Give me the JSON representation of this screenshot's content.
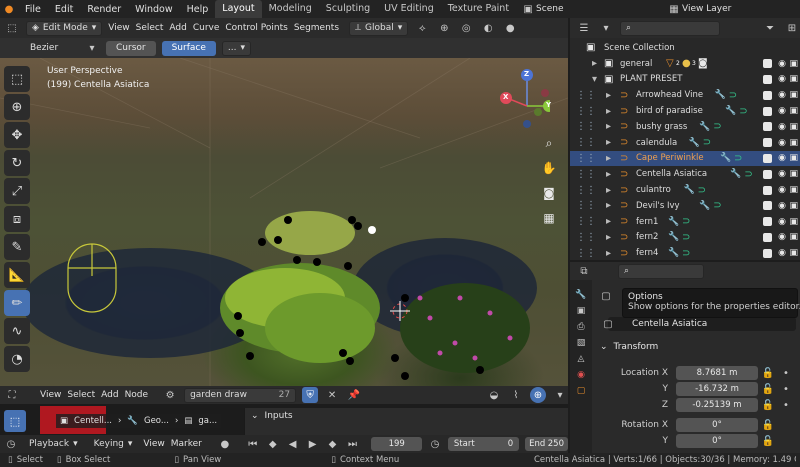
{
  "menu": {
    "items": [
      "File",
      "Edit",
      "Render",
      "Window",
      "Help"
    ],
    "workspaces": [
      "Layout",
      "Modeling",
      "Sculpting",
      "UV Editing",
      "Texture Paint"
    ],
    "active_workspace": "Layout",
    "scene_label": "Scene",
    "view_layer_label": "View Layer"
  },
  "viewport_header": {
    "mode": "Edit Mode",
    "menus": [
      "View",
      "Select",
      "Add",
      "Curve",
      "Control Points",
      "Segments"
    ],
    "orientation": "Global"
  },
  "curve_bar": {
    "type": "Bezier",
    "cursor_label": "Cursor",
    "surface_label": "Surface",
    "more": "..."
  },
  "viewport": {
    "perspective": "User Perspective",
    "object_info": "(199) Centella Asiatica",
    "gizmo": {
      "x": "X",
      "y": "Y",
      "z": "Z"
    },
    "toolbar": [
      "select-box-icon",
      "cursor-icon",
      "move-icon",
      "rotate-icon",
      "scale-icon",
      "transform-icon",
      "annotate-icon",
      "measure-icon",
      "draw-icon",
      "pen-icon",
      "radius-icon"
    ],
    "active_tool": 8
  },
  "outliner": {
    "collection": "Scene Collection",
    "general": "general",
    "general_counts": [
      "2",
      "3"
    ],
    "preset": "PLANT PRESET",
    "items": [
      "Arrowhead Vine",
      "bird of paradise",
      "bushy grass",
      "calendula",
      "Cape Periwinkle",
      "Centella Asiatica",
      "culantro",
      "Devil's Ivy",
      "fern1",
      "fern2",
      "fern4"
    ],
    "selected_index": 4,
    "active_index": 5
  },
  "properties": {
    "tooltip_title": "Options",
    "tooltip_desc": "Show options for the properties editor.",
    "object_name": "Centella Asiatica",
    "transform_label": "Transform",
    "location_label": "Location X",
    "loc_y_label": "Y",
    "loc_z_label": "Z",
    "location": [
      "8.7681 m",
      "-16.732 m",
      "-0.25139 m"
    ],
    "rotation_label": "Rotation X",
    "rot_y_label": "Y",
    "rotation": [
      "0°",
      "0°"
    ]
  },
  "node_editor": {
    "menus": [
      "View",
      "Select",
      "Add",
      "Node"
    ],
    "group_name": "garden draw",
    "users": "27",
    "breadcrumb": [
      "Centell...",
      "Geo...",
      "ga..."
    ],
    "inputs_label": "Inputs"
  },
  "timeline": {
    "playback": "Playback",
    "keying": "Keying",
    "view": "View",
    "marker": "Marker",
    "current_frame": "199",
    "start_label": "Start",
    "start": "0",
    "end_label": "End",
    "end": "250"
  },
  "status": {
    "select": "Select",
    "box_select": "Box Select",
    "pan_view": "Pan View",
    "context_menu": "Context Menu",
    "info": "Centella Asiatica | Verts:1/66 | Objects:30/36 | Memory: 1.49 GiB | V..."
  },
  "colors": {
    "accent": "#4772b3",
    "orange": "#e08a2c",
    "green": "#34c58c"
  }
}
